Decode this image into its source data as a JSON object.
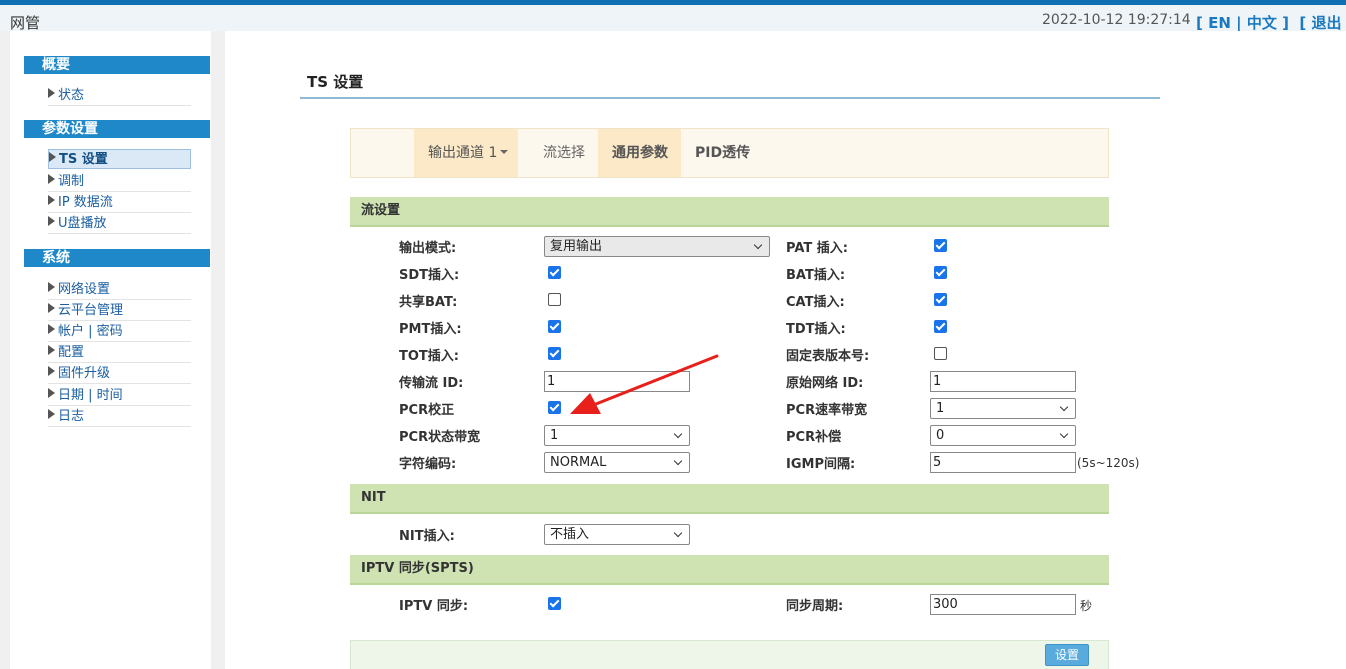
{
  "app": {
    "title": "网管"
  },
  "header": {
    "datetime": "2022-10-12 19:27:14",
    "lang_en": "EN",
    "lang_sep": "|",
    "lang_zh": "中文",
    "logout": "退出",
    "bracket_open": "[",
    "bracket_close": "]"
  },
  "sidebar": {
    "groups": [
      {
        "title": "概要",
        "items": [
          "状态"
        ]
      },
      {
        "title": "参数设置",
        "items": [
          "TS 设置",
          "调制",
          "IP 数据流",
          "U盘播放"
        ]
      },
      {
        "title": "系统",
        "items": [
          "网络设置",
          "云平台管理",
          "帐户 | 密码",
          "配置",
          "固件升级",
          "日期 | 时间",
          "日志"
        ]
      }
    ],
    "active": "TS 设置"
  },
  "page": {
    "title": "TS 设置"
  },
  "tabs": [
    {
      "label": "输出通道 1"
    },
    {
      "label": "流选择"
    },
    {
      "label": "通用参数"
    },
    {
      "label": "PID透传"
    }
  ],
  "stream": {
    "title": "流设置",
    "output_mode_label": "输出模式:",
    "output_mode_value": "复用输出",
    "pat_label": "PAT 插入:",
    "pat": true,
    "sdt_label": "SDT插入:",
    "sdt": true,
    "bat_label": "BAT插入:",
    "bat": true,
    "share_bat_label": "共享BAT:",
    "share_bat": false,
    "cat_label": "CAT插入:",
    "cat": true,
    "pmt_label": "PMT插入:",
    "pmt": true,
    "tdt_label": "TDT插入:",
    "tdt": true,
    "tot_label": "TOT插入:",
    "tot": true,
    "fixed_ver_label": "固定表版本号:",
    "fixed_ver": false,
    "tsid_label": "传输流 ID:",
    "tsid": "1",
    "onid_label": "原始网络 ID:",
    "onid": "1",
    "pcr_correct_label": "PCR校正",
    "pcr_correct": true,
    "pcr_rate_bw_label": "PCR速率带宽",
    "pcr_rate_bw": "1",
    "pcr_state_bw_label": "PCR状态带宽",
    "pcr_state_bw": "1",
    "pcr_comp_label": "PCR补偿",
    "pcr_comp": "0",
    "charset_label": "字符编码:",
    "charset": "NORMAL",
    "igmp_label": "IGMP间隔:",
    "igmp": "5",
    "igmp_hint": "(5s~120s)"
  },
  "nit": {
    "title": "NIT",
    "insert_label": "NIT插入:",
    "insert_value": "不插入"
  },
  "iptv": {
    "title": "IPTV 同步(SPTS)",
    "sync_label": "IPTV 同步:",
    "sync": true,
    "period_label": "同步周期:",
    "period": "300",
    "period_unit": "秒"
  },
  "actions": {
    "set_label": "设置"
  },
  "colors": {
    "accent": "#1e88c9",
    "section_bg": "#cfe3b2",
    "tab_active": "#fbe9c8",
    "checkbox": "#1a73e8",
    "arrow": "#e8201c"
  }
}
